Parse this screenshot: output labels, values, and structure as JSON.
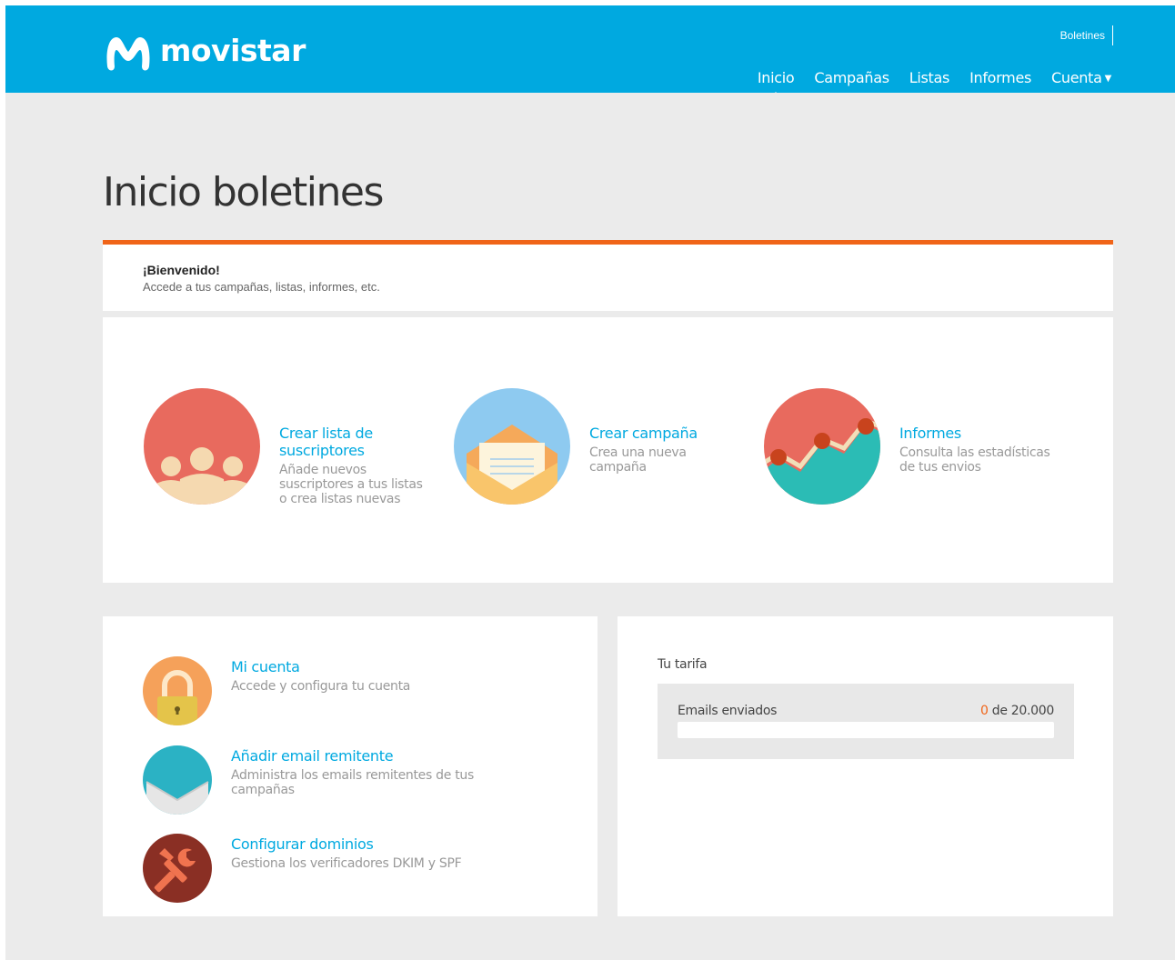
{
  "header": {
    "logo_text": "movistar",
    "app_name": "Boletines",
    "nav": [
      {
        "label": "Inicio",
        "active": true
      },
      {
        "label": "Campañas"
      },
      {
        "label": "Listas"
      },
      {
        "label": "Informes"
      },
      {
        "label": "Cuenta"
      }
    ],
    "brand_color": "#00a9e0"
  },
  "page": {
    "title": "Inicio boletines",
    "accent_color": "#f06418"
  },
  "welcome": {
    "title": "¡Bienvenido!",
    "subtitle": "Accede a tus campañas, listas, informes, etc."
  },
  "actions": [
    {
      "icon": "subscribers-icon",
      "title": "Crear lista de suscriptores",
      "desc": "Añade nuevos suscriptores a tus listas o crea listas nuevas"
    },
    {
      "icon": "envelope-icon",
      "title": "Crear campaña",
      "desc": "Crea una nueva campaña"
    },
    {
      "icon": "chart-icon",
      "title": "Informes",
      "desc": "Consulta las estadísticas de tus envios"
    }
  ],
  "account": [
    {
      "icon": "lock-icon",
      "title": "Mi cuenta",
      "desc": "Accede y configura tu cuenta"
    },
    {
      "icon": "add-email-icon",
      "title": "Añadir email remitente",
      "desc": "Administra los emails remitentes de tus campañas"
    },
    {
      "icon": "tools-icon",
      "title": "Configurar dominios",
      "desc": "Gestiona los verificadores DKIM y SPF"
    }
  ],
  "plan": {
    "title": "Tu tarifa",
    "emails_label": "Emails enviados",
    "sent": "0",
    "of_text": "de 20.000",
    "progress_fraction": 0
  }
}
